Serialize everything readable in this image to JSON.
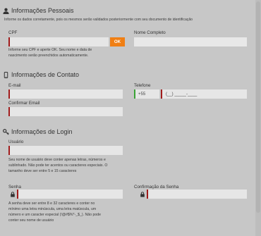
{
  "personal": {
    "title": "Informações Pessoais",
    "subtitle": "Informe os dados corretamente, pois os mesmos serão validados posteriormente com seu documento de identificação",
    "cpf_label": "CPF",
    "cpf_value": "",
    "ok_label": "OK",
    "cpf_hint_1": "Informe seu CPF e aperte OK. Seu nome e data de",
    "cpf_hint_2": "nascimento serão preenchidos automaticamente.",
    "name_label": "Nome Completo",
    "name_value": ""
  },
  "contact": {
    "title": "Informações de Contato",
    "email_label": "E-mail",
    "email_value": "",
    "confirm_email_label": "Confirmar Email",
    "confirm_email_value": "",
    "phone_label": "Telefone",
    "phone_prefix": "+55",
    "phone_mask": "(__) _____-____"
  },
  "login": {
    "title": "Informações de Login",
    "user_label": "Usuário",
    "user_value": "",
    "user_hint_1": "Seu nome de usuário deve conter apenas letras, números e",
    "user_hint_2": "sublinhado. Não pode ter acentos ou caracteres especiais. O",
    "user_hint_3": "tamanho deve ser entre 5 e 15 caracteres",
    "password_label": "Senha",
    "password_value": "",
    "confirm_password_label": "Confirmação da Senha",
    "confirm_password_value": "",
    "password_hint_1": "A senha deve ser entre 8 e 32 caracteres e conter no",
    "password_hint_2": "mínimo uma letra minúscula, uma letra maiúscula, um",
    "password_hint_3": "número e um caracter especial (!@#$%*-_$_). Não pode",
    "password_hint_4": "conter seu nome de usuário"
  },
  "icons": {
    "personal": "user-icon",
    "contact": "mobile-phone-icon",
    "login": "key-icon",
    "password": "lock-icon"
  },
  "colors": {
    "background": "#c7c7c7",
    "required_marker": "#a11b1b",
    "valid_marker": "#3aa336",
    "ok_button": "#f07f14"
  }
}
